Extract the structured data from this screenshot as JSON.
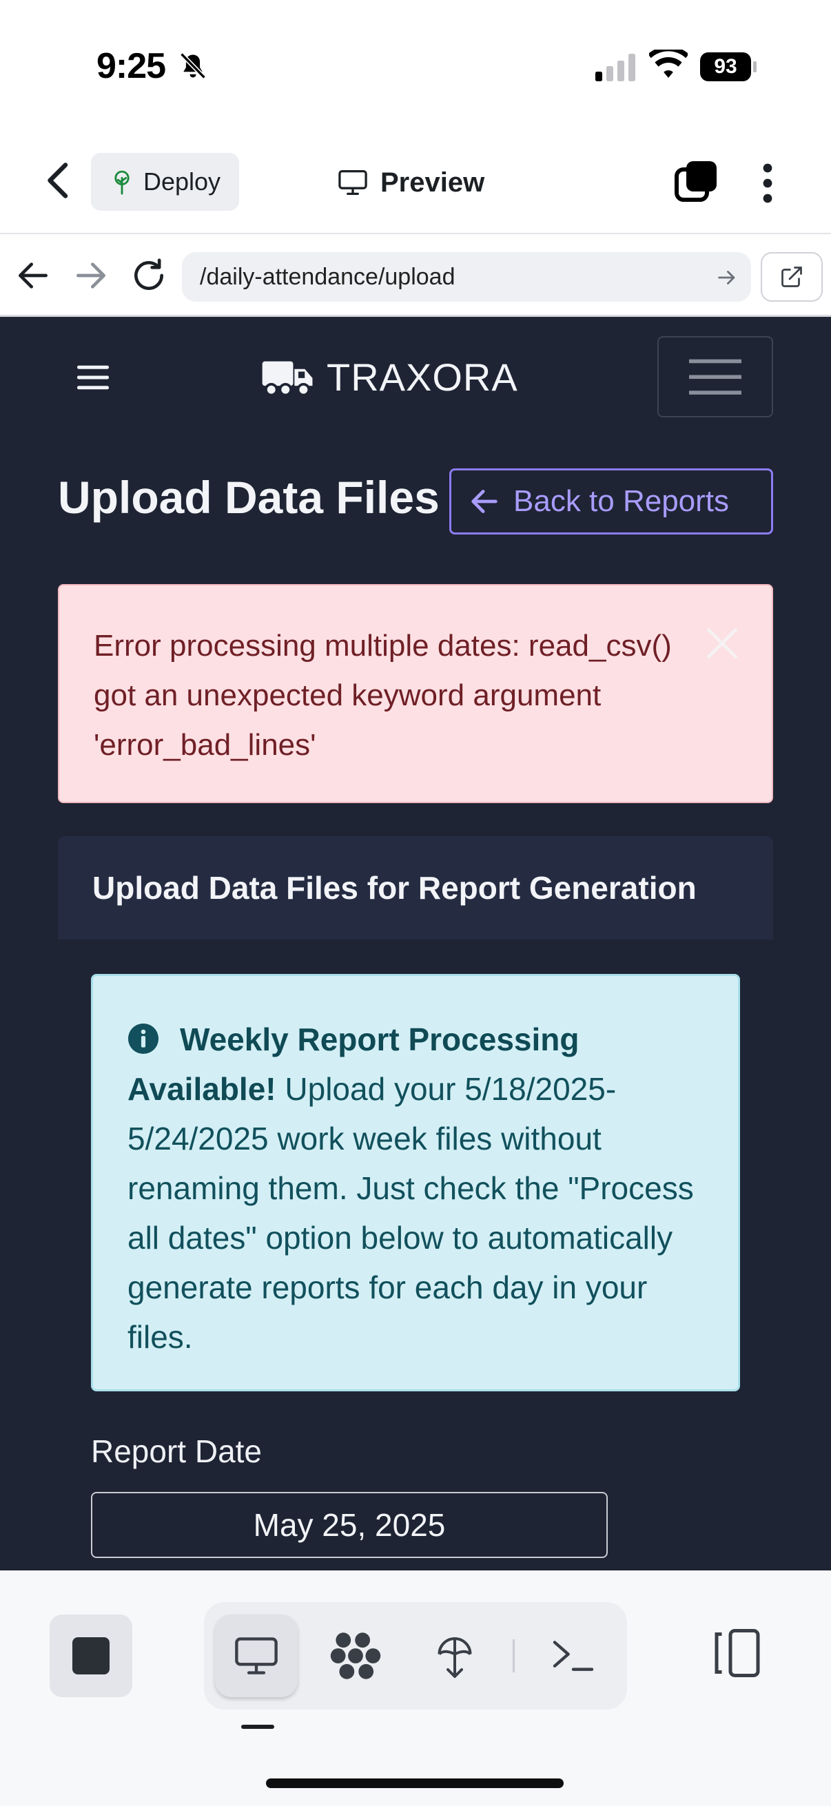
{
  "status_bar": {
    "time": "9:25",
    "battery": "93"
  },
  "top_bar": {
    "deploy_label": "Deploy",
    "preview_label": "Preview"
  },
  "browser": {
    "url": "/daily-attendance/upload"
  },
  "app": {
    "brand": "TRAXORA",
    "page_title": "Upload Data Files",
    "back_label": "Back to Reports",
    "error_message": "Error processing multiple dates: read_csv() got an unexpected keyword argument 'error_bad_lines'",
    "card_title": "Upload Data Files for Report Generation",
    "info_strong": "Weekly Report Processing Available!",
    "info_text": "Upload your 5/18/2025-5/24/2025 work week files without renaming them. Just check the \"Process all dates\" option below to automatically generate reports for each day in your files.",
    "date_label": "Report Date",
    "date_value": "May 25, 2025"
  },
  "colors": {
    "app_bg": "#1e2433",
    "accent": "#8b7cf2",
    "error_bg": "#fde0e3",
    "info_bg": "#d3eff5"
  },
  "icons": {
    "back": "chevron-left-icon",
    "deploy": "deploy-tree-icon",
    "preview": "monitor-icon",
    "truck": "truck-icon",
    "info": "info-circle-icon"
  }
}
